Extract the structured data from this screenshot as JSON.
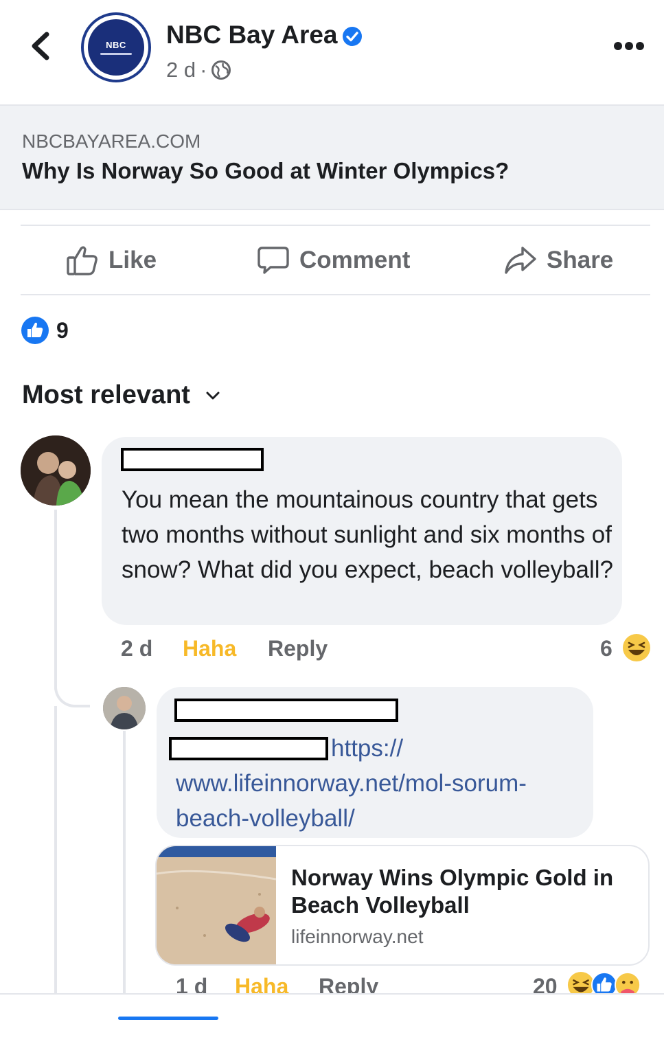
{
  "header": {
    "page_name": "NBC Bay Area",
    "logo_text": "NBC",
    "time": "2 d",
    "separator": "·"
  },
  "link_preview": {
    "domain": "NBCBAYAREA.COM",
    "title": "Why Is Norway So Good at Winter Olympics?"
  },
  "actions": {
    "like": "Like",
    "comment": "Comment",
    "share": "Share"
  },
  "reactions": {
    "count": "9"
  },
  "sort": {
    "label": "Most relevant"
  },
  "comments": [
    {
      "text": "You mean the mountainous country that gets two months without sunlight and six months of snow?  What did you expect, beach volleyball?",
      "time": "2 d",
      "haha": "Haha",
      "reply": "Reply",
      "reaction_count": "6"
    },
    {
      "link_text": "https:// www.lifeinnorway.net/mol-sorum-beach-volleyball/",
      "card": {
        "title": "Norway Wins Olympic Gold in Beach Volleyball",
        "domain": "lifeinnorway.net"
      },
      "time": "1 d",
      "haha": "Haha",
      "reply": "Reply",
      "reaction_count": "20"
    }
  ],
  "colors": {
    "brand_blue": "#1877f2",
    "link_blue": "#385898",
    "haha_yellow": "#f7b928",
    "text_gray": "#65676b"
  }
}
